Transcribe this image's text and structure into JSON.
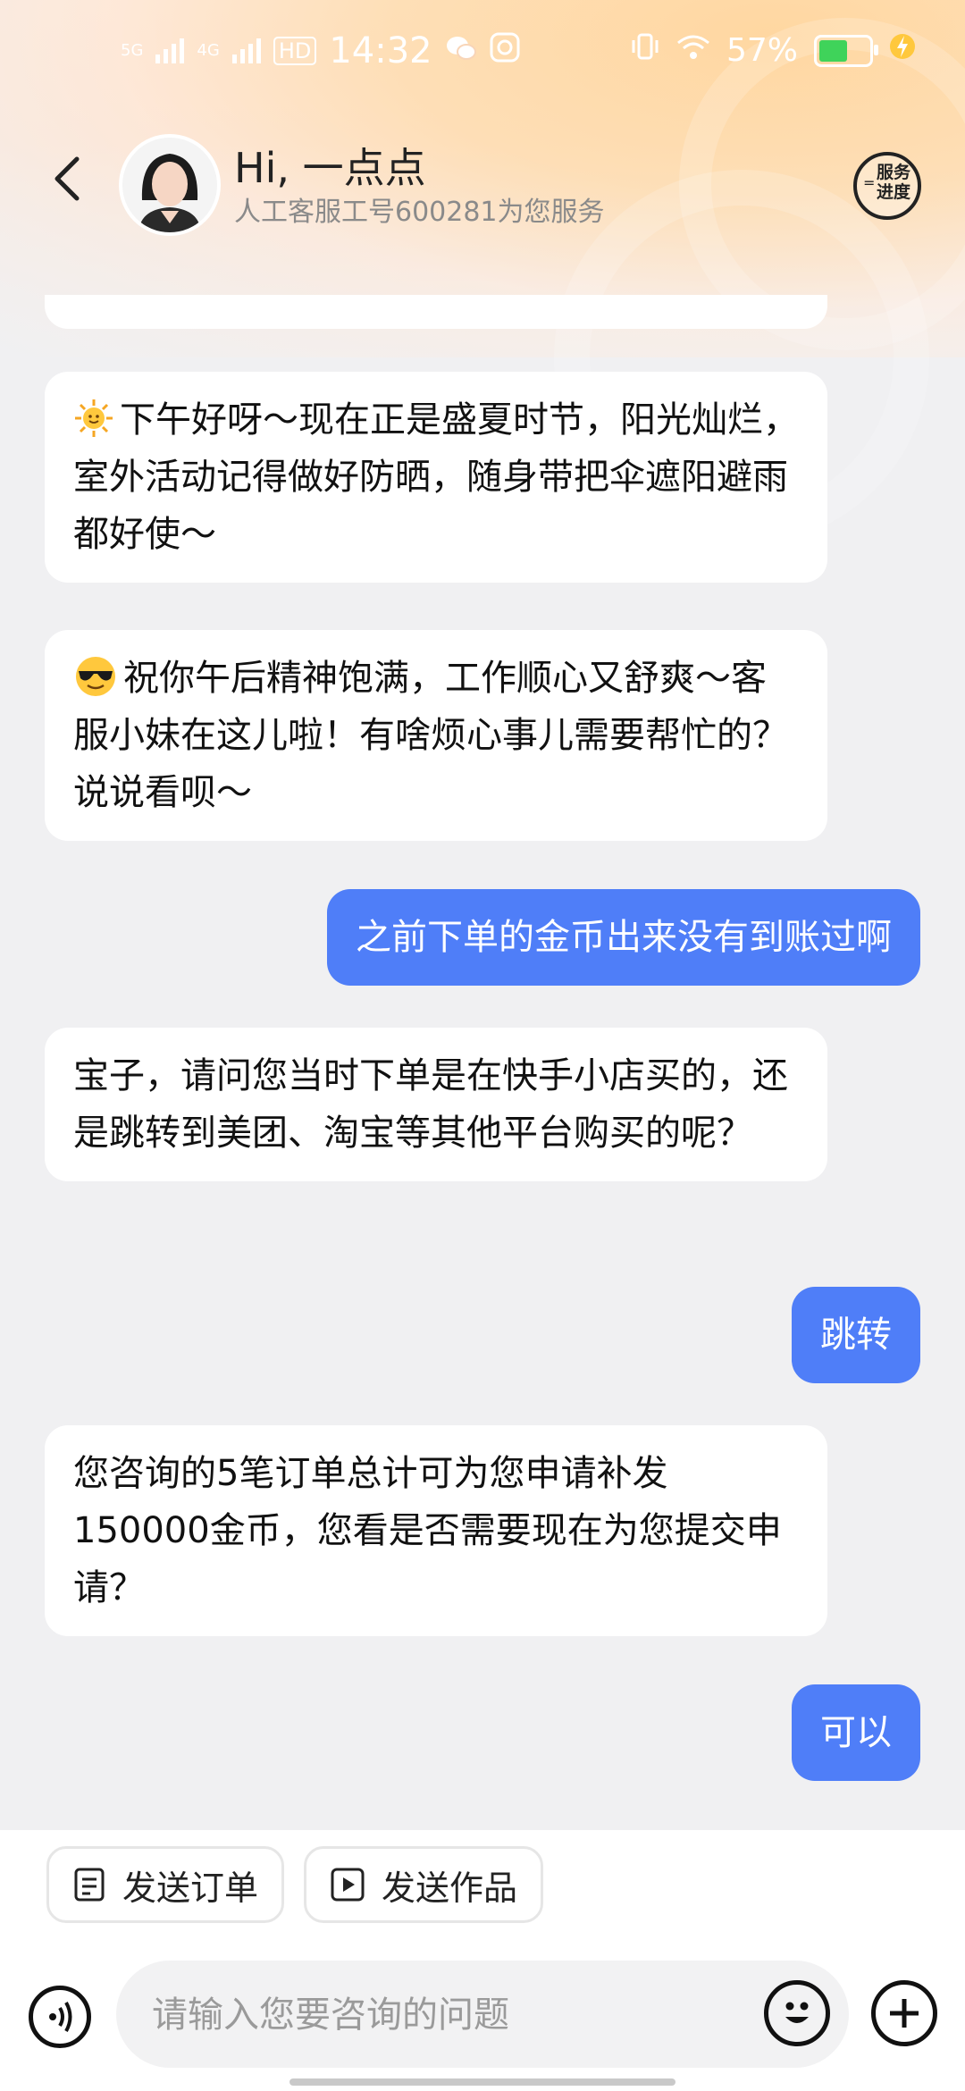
{
  "status_bar": {
    "network1": "5G",
    "network2": "4G",
    "hd_label": "HD",
    "time": "14:32",
    "battery_percent": "57%",
    "battery_level": 0.57,
    "battery_color": "#3fd35a"
  },
  "header": {
    "title": "Hi, 一点点",
    "subtitle": "人工客服工号600281为您服务",
    "progress_label_line1": "服务",
    "progress_label_line2": "进度"
  },
  "messages": [
    {
      "side": "left",
      "icon": "sun-emoji",
      "text": "下午好呀～现在正是盛夏时节，阳光灿烂，室外活动记得做好防晒，随身带把伞遮阳避雨都好使～"
    },
    {
      "side": "left",
      "icon": "sunglasses-emoji",
      "text": "祝你午后精神饱满，工作顺心又舒爽～客服小妹在这儿啦！有啥烦心事儿需要帮忙的？说说看呗～"
    },
    {
      "side": "right",
      "text": "之前下单的金币出来没有到账过啊"
    },
    {
      "side": "left",
      "text": "宝子，请问您当时下单是在快手小店买的，还是跳转到美团、淘宝等其他平台购买的呢？"
    },
    {
      "side": "right",
      "text": "跳转"
    },
    {
      "side": "left",
      "text": "您咨询的5笔订单总计可为您申请补发150000金币，您看是否需要现在为您提交申请？"
    },
    {
      "side": "right",
      "text": "可以"
    }
  ],
  "quick_actions": {
    "send_order": "发送订单",
    "send_work": "发送作品"
  },
  "input": {
    "placeholder": "请输入您要咨询的问题"
  },
  "colors": {
    "accent": "#4f7ef8",
    "bubble_left": "#ffffff",
    "background": "#f0f0f2"
  }
}
